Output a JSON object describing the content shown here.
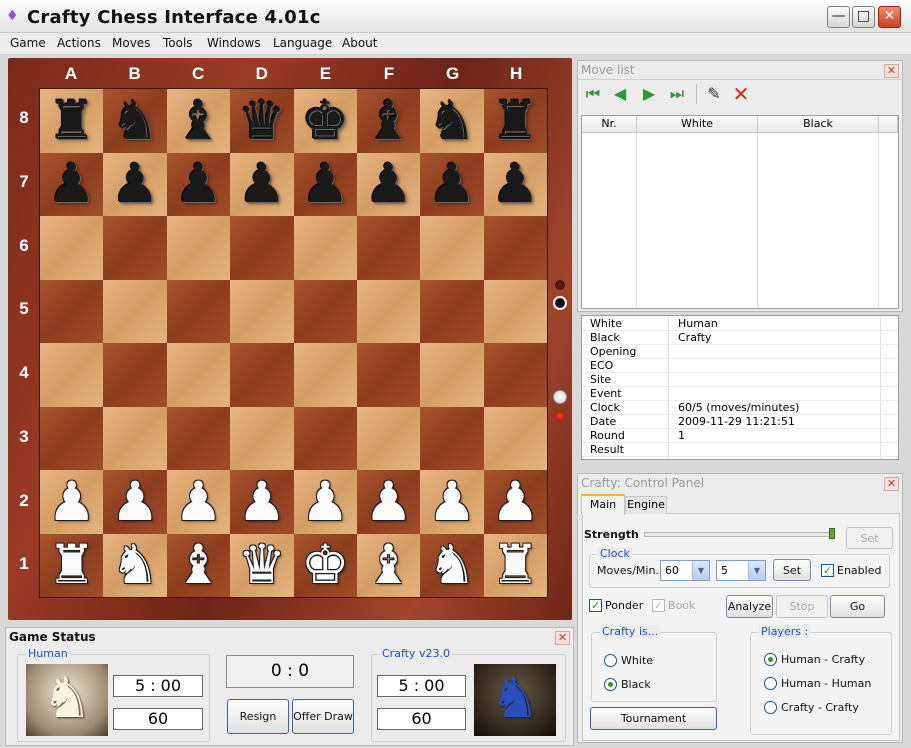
{
  "window": {
    "title": "Crafty Chess Interface 4.01c"
  },
  "menu": [
    "Game",
    "Actions",
    "Moves",
    "Tools",
    "Windows",
    "Language",
    "About"
  ],
  "board": {
    "files": [
      "A",
      "B",
      "C",
      "D",
      "E",
      "F",
      "G",
      "H"
    ],
    "ranks": [
      "8",
      "7",
      "6",
      "5",
      "4",
      "3",
      "2",
      "1"
    ],
    "position": [
      [
        "br",
        "bn",
        "bb",
        "bq",
        "bk",
        "bb",
        "bn",
        "br"
      ],
      [
        "bp",
        "bp",
        "bp",
        "bp",
        "bp",
        "bp",
        "bp",
        "bp"
      ],
      [
        "",
        "",
        "",
        "",
        "",
        "",
        "",
        ""
      ],
      [
        "",
        "",
        "",
        "",
        "",
        "",
        "",
        ""
      ],
      [
        "",
        "",
        "",
        "",
        "",
        "",
        "",
        ""
      ],
      [
        "",
        "",
        "",
        "",
        "",
        "",
        "",
        ""
      ],
      [
        "wp",
        "wp",
        "wp",
        "wp",
        "wp",
        "wp",
        "wp",
        "wp"
      ],
      [
        "wr",
        "wn",
        "wb",
        "wq",
        "wk",
        "wb",
        "wn",
        "wr"
      ]
    ]
  },
  "move_list": {
    "title": "Move list",
    "toolbar": [
      "first-move-icon",
      "previous-move-icon",
      "next-move-icon",
      "last-move-icon",
      "pencil-icon",
      "delete-icon"
    ],
    "columns": [
      "Nr.",
      "White",
      "Black"
    ]
  },
  "game_info": [
    {
      "key": "White",
      "value": "Human"
    },
    {
      "key": "Black",
      "value": "Crafty"
    },
    {
      "key": "Opening",
      "value": ""
    },
    {
      "key": "ECO",
      "value": ""
    },
    {
      "key": "Site",
      "value": ""
    },
    {
      "key": "Event",
      "value": ""
    },
    {
      "key": "Clock",
      "value": "60/5 (moves/minutes)"
    },
    {
      "key": "Date",
      "value": "2009-11-29 11:21:51"
    },
    {
      "key": "Round",
      "value": "1"
    },
    {
      "key": "Result",
      "value": ""
    }
  ],
  "control_panel": {
    "title": "Crafty: Control Panel",
    "tabs": [
      "Main",
      "Engine"
    ],
    "strength_label": "Strength",
    "set_label": "Set",
    "clock": {
      "group_label": "Clock",
      "moves_label": "Moves/Min.",
      "moves_value": "60",
      "minutes_value": "5",
      "set_label": "Set",
      "enabled_label": "Enabled",
      "enabled": true
    },
    "ponder_label": "Ponder",
    "ponder": true,
    "book_label": "Book",
    "book": true,
    "analyze_label": "Analyze",
    "stop_label": "Stop",
    "go_label": "Go",
    "crafty_is": {
      "group_label": "Crafty is...",
      "options": [
        "White",
        "Black"
      ],
      "selected": "Black"
    },
    "players": {
      "group_label": "Players :",
      "options": [
        "Human - Crafty",
        "Human - Human",
        "Crafty - Crafty"
      ],
      "selected": "Human - Crafty"
    },
    "tournament_label": "Tournament"
  },
  "game_status": {
    "title": "Game Status",
    "human": {
      "label": "Human",
      "time": "5 : 00",
      "moves": "60"
    },
    "score": "0 : 0",
    "resign_label": "Resign",
    "offer_draw_label": "Offer Draw",
    "crafty": {
      "label": "Crafty v23.0",
      "time": "5 : 00",
      "moves": "60"
    }
  },
  "colors": {
    "accent": "#1a4ec8",
    "board_light": "#e2ad78",
    "board_dark": "#9a4726",
    "frame": "#8b3320",
    "check_green": "#21a121"
  }
}
